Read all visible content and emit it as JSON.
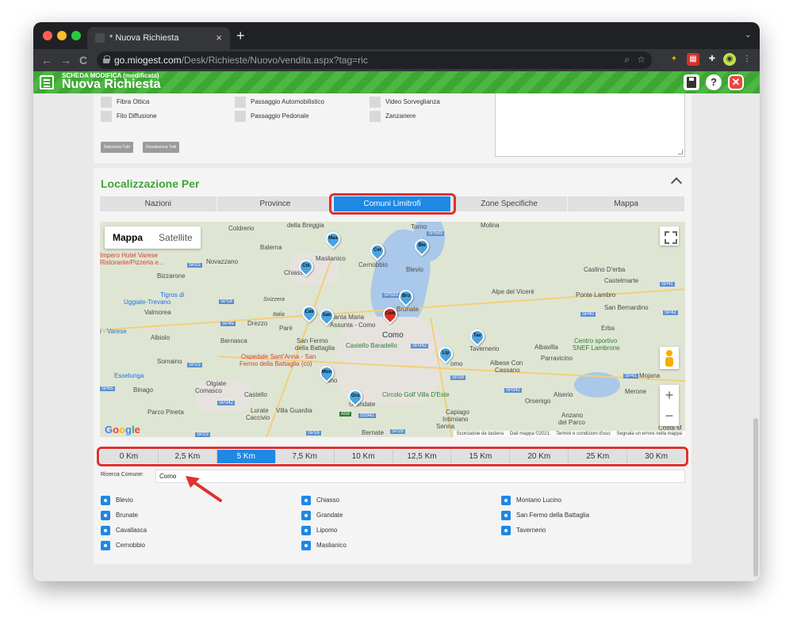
{
  "browser": {
    "tab_title": "* Nuova Richiesta",
    "new_tab": "+",
    "tab_close": "×",
    "url_domain": "go.miogest.com",
    "url_path": "/Desk/Richieste/Nuovo/vendita.aspx?tag=ric",
    "back": "←",
    "forward": "→",
    "reload": "C"
  },
  "header": {
    "subtitle": "SCHEDA MODIFICA (modificata)",
    "title": "Nuova Richiesta",
    "help": "?",
    "close": "✕"
  },
  "features": {
    "items": [
      {
        "label": "Fibra Ottica"
      },
      {
        "label": "Passaggio Automobilistico"
      },
      {
        "label": "Video Sorveglianza"
      },
      {
        "label": "Filo Diffusione"
      },
      {
        "label": "Passaggio Pedonale"
      },
      {
        "label": "Zanzariere"
      }
    ],
    "select_all": "Seleziona Tutti",
    "deselect_all": "Deseleziona Tutti"
  },
  "localization": {
    "title": "Localizzazione Per",
    "tabs": [
      "Nazioni",
      "Province",
      "Comuni Limitrofi",
      "Zone Specifiche",
      "Mappa"
    ],
    "active_tab": "Comuni Limitrofi"
  },
  "map": {
    "toggle": {
      "map": "Mappa",
      "satellite": "Satellite"
    },
    "labels": {
      "coldrerio": "Coldrerio",
      "breggia": "della Breggia",
      "torno": "Torno",
      "molina": "Molina",
      "balerna": "Balerna",
      "maslianico": "Maslianico",
      "cernobbio": "Cernobbio",
      "blevio": "Blevio",
      "novazzano": "Novazzano",
      "chiasso": "Chiasso",
      "hotel": "Impero Hotel Varese",
      "pizzeria": "Ristorante/Pizzeria e...",
      "bizzarone": "Bizzarone",
      "caslino": "Caslino D'erba",
      "castelmarte": "Castelmarte",
      "tigros": "Tigros di",
      "uggiate": "Uggiate-Trevano",
      "svizzera": "Svizzera",
      "viceré": "Alpe del Viceré",
      "ponte": "Ponte Lambro",
      "bernardino": "San Bernardino",
      "valmorea": "Valmorea",
      "italia": "Italia",
      "santamaria": "Santa Maria",
      "assunta": "Assunta - Como",
      "brunate": "Brunate",
      "drezzo": "Drezzo",
      "pare": "Parè",
      "erba": "Erba",
      "varese": "i - Varese",
      "albiolo": "Albiolo",
      "bernasca": "Bernasca",
      "sanfermo": "San Fermo",
      "battaglia": "della Battaglia",
      "baradello": "Castello Baradello",
      "como": "Como",
      "tavernerio": "Tavernerio",
      "albavilla": "Albavilla",
      "sportivo": "Centro sportivo",
      "snef": "SNEF Lambrone",
      "ospedale": "Ospedale Sant'Anna - San",
      "fermo": "Fermo della Battaglia (co)",
      "somaino": "Somaino",
      "albese": "Albese Con",
      "cassano": "Cassano",
      "parravicino": "Parravicino",
      "esselunga": "Esselunga",
      "olgiate": "Olgiate",
      "comasco": "Comasco",
      "binago": "Binago",
      "castello": "Castello",
      "circolo": "Circolo Golf Villa D'Este",
      "alserio": "Alserio",
      "merone": "Merone",
      "mojana": "Mojana",
      "orsenigo": "Orsenigo",
      "lurate": "Lurate",
      "caccivio": "Caccivio",
      "villa": "Villa Guardia",
      "grandate": "Grandate",
      "capiago": "Capiago",
      "intimiano": "Intimiano",
      "senna": "Senna",
      "anzano": "Anzano",
      "parco": "del Parco",
      "bernate": "Bernate",
      "parco_pineta": "Parco Pineta",
      "costa": "Costa M",
      "lipomo": "omo",
      "mon_town": "ano"
    },
    "roads": [
      "SP583",
      "SP583",
      "SP23",
      "SP41",
      "SP18",
      "SP45",
      "SP40",
      "SP342",
      "SP342",
      "SP342",
      "SP23",
      "SP28",
      "SP41",
      "SS342",
      "A59",
      "SP28",
      "SP28",
      "SP23",
      "SP65",
      "SP42"
    ],
    "pins": [
      "Mas",
      "Cer",
      "Ble",
      "Chi",
      "Bru",
      "Cav",
      "San",
      "Com",
      "Tav",
      "Lip",
      "Mon",
      "Gra"
    ],
    "google": [
      "G",
      "o",
      "o",
      "g",
      "l",
      "e"
    ],
    "attribution": [
      "Scorciatoie da tastiera",
      "Dati mappa ©2021",
      "Termini e condizioni d'uso",
      "Segnala un errore nella mappa"
    ],
    "zoom_in": "+",
    "zoom_out": "−"
  },
  "distance": {
    "options": [
      "0 Km",
      "2,5 Km",
      "5 Km",
      "7,5 Km",
      "10 Km",
      "12,5 Km",
      "15 Km",
      "20 Km",
      "25 Km",
      "30 Km"
    ],
    "active": "5 Km"
  },
  "search": {
    "label": "Ricerca Comune:",
    "value": "Como"
  },
  "results": {
    "col1": [
      "Blevio",
      "Brunate",
      "Cavallasca",
      "Cernobbio"
    ],
    "col2": [
      "Chiasso",
      "Grandate",
      "Lipomo",
      "Maslianico"
    ],
    "col3": [
      "Montano Lucino",
      "San Fermo della Battaglia",
      "Tavernerio"
    ]
  },
  "colors": {
    "brand_green": "#3fa535",
    "accent_blue": "#1e88e5",
    "highlight_red": "#e03030"
  }
}
